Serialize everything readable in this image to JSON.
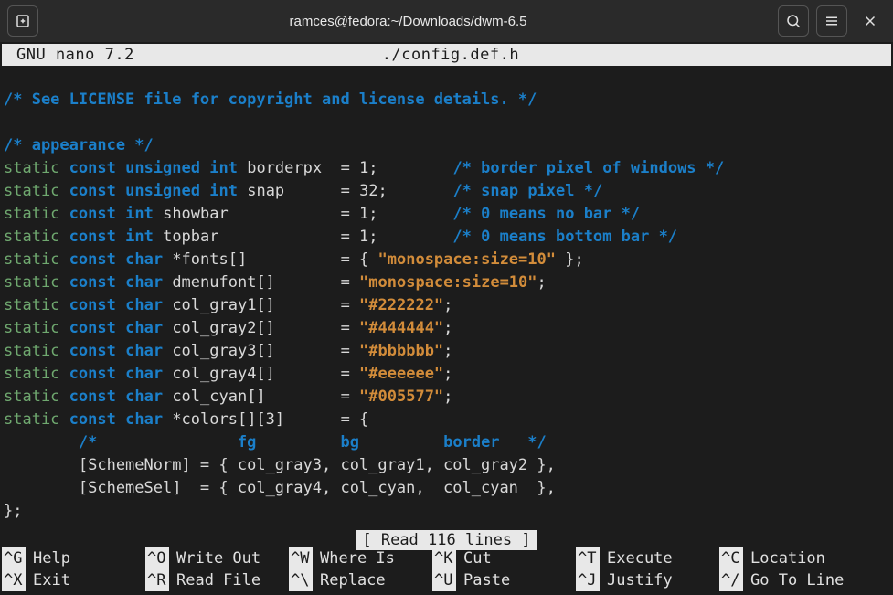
{
  "titlebar": {
    "title": "ramces@fedora:~/Downloads/dwm-6.5"
  },
  "nano": {
    "version": "GNU nano 7.2",
    "filename": "./config.def.h",
    "status": "[ Read 116 lines ]"
  },
  "code": {
    "l1": "/* See LICENSE file for copyright and license details. */",
    "l3": "/* appearance */",
    "static": "static",
    "const": "const",
    "unsigned": "unsigned",
    "int": "int",
    "char": "char",
    "borderpx": "borderpx",
    "snap": "snap",
    "showbar": "showbar",
    "topbar": "topbar",
    "fonts": "*fonts[]",
    "dmenufont": "dmenufont[]",
    "col_gray1": "col_gray1[]",
    "col_gray2": "col_gray2[]",
    "col_gray3": "col_gray3[]",
    "col_gray4": "col_gray4[]",
    "col_cyan": "col_cyan[]",
    "colors": "*colors[][3]",
    "v_borderpx": "= 1;",
    "v_snap": "= 32;",
    "v_showbar": "= 1;",
    "v_topbar": "= 1;",
    "v_fonts_open": "= { ",
    "v_fonts_str": "\"monospace:size=10\"",
    "v_fonts_close": " };",
    "v_dmenu_eq": "= ",
    "v_dmenu_str": "\"monospace:size=10\"",
    "v_dmenu_end": ";",
    "v_g1_str": "\"#222222\"",
    "v_g2_str": "\"#444444\"",
    "v_g3_str": "\"#bbbbbb\"",
    "v_g4_str": "\"#eeeeee\"",
    "v_cyan_str": "\"#005577\"",
    "v_colors_eq": "= {",
    "c_borderpx": "/* border pixel of windows */",
    "c_snap": "/* snap pixel */",
    "c_showbar": "/* 0 means no bar */",
    "c_topbar": "/* 0 means bottom bar */",
    "c_header_open": "/*",
    "c_header_fg": "fg",
    "c_header_bg": "bg",
    "c_header_border": "border",
    "c_header_close": "*/",
    "scheme_norm": "        [SchemeNorm] = { col_gray3, col_gray1, col_gray2 },",
    "scheme_sel": "        [SchemeSel]  = { col_gray4, col_cyan,  col_cyan  },",
    "close_brace": "};"
  },
  "shortcuts": {
    "row1": [
      {
        "key": "^G",
        "label": "Help"
      },
      {
        "key": "^O",
        "label": "Write Out"
      },
      {
        "key": "^W",
        "label": "Where Is"
      },
      {
        "key": "^K",
        "label": "Cut"
      },
      {
        "key": "^T",
        "label": "Execute"
      },
      {
        "key": "^C",
        "label": "Location"
      }
    ],
    "row2": [
      {
        "key": "^X",
        "label": "Exit"
      },
      {
        "key": "^R",
        "label": "Read File"
      },
      {
        "key": "^\\",
        "label": "Replace"
      },
      {
        "key": "^U",
        "label": "Paste"
      },
      {
        "key": "^J",
        "label": "Justify"
      },
      {
        "key": "^/",
        "label": "Go To Line"
      }
    ]
  }
}
